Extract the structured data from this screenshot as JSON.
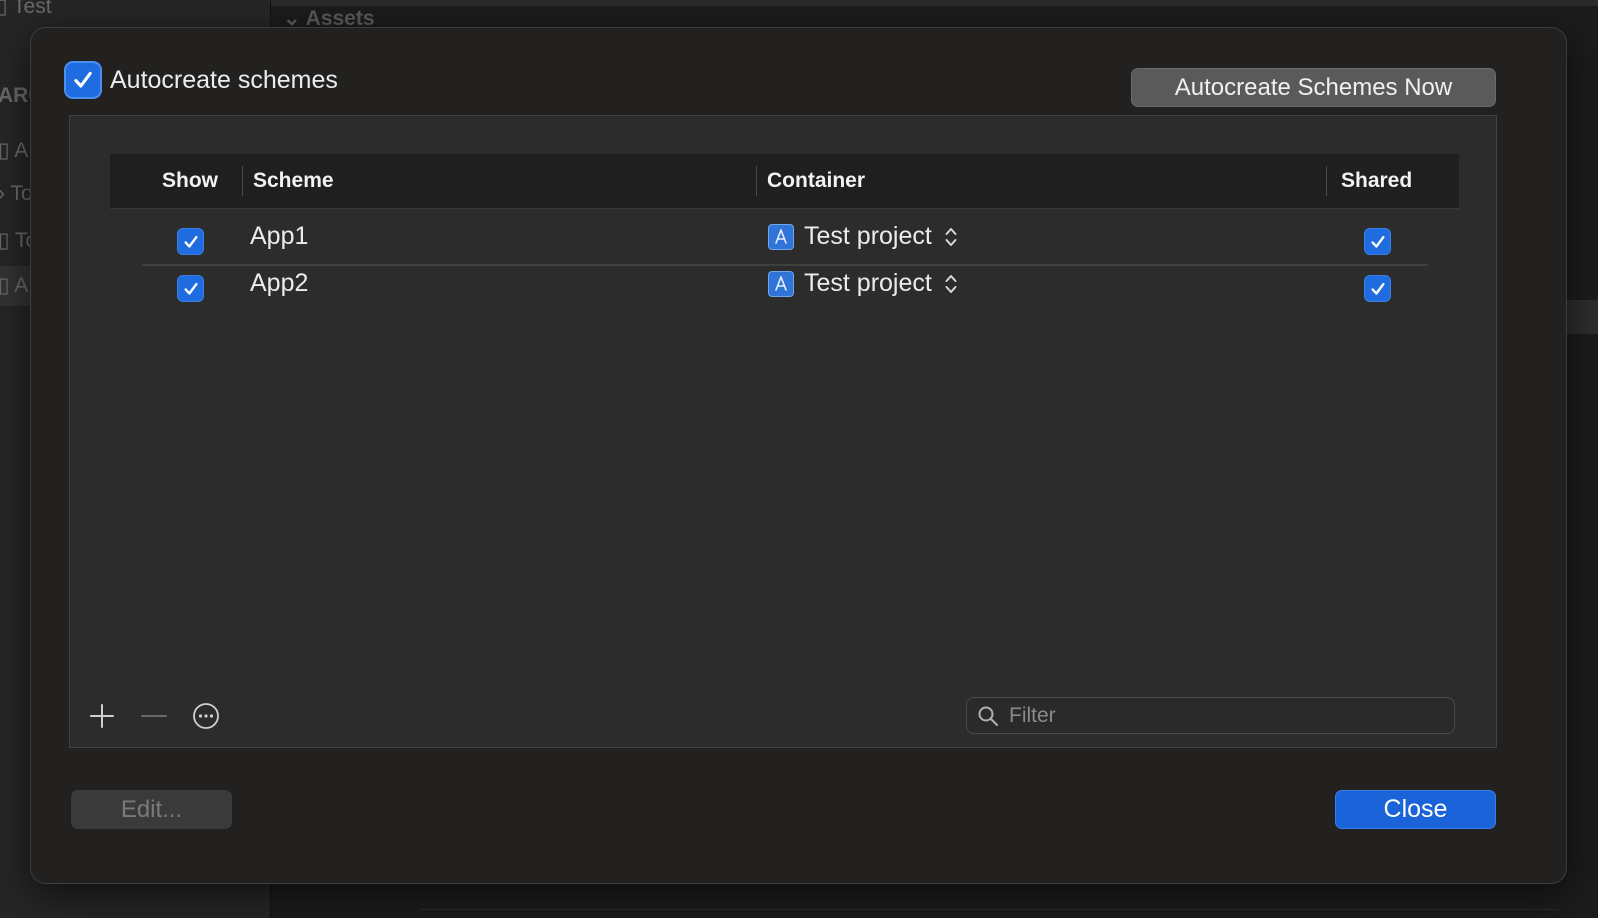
{
  "background": {
    "sidebar_items": [
      "Test",
      "ARC",
      "A",
      "To",
      "To",
      "A"
    ],
    "section_title": "Assets"
  },
  "dialog": {
    "autocreate_label": "Autocreate schemes",
    "autocreate_checked": true,
    "autocreate_now_button": "Autocreate Schemes Now",
    "columns": {
      "show": "Show",
      "scheme": "Scheme",
      "container": "Container",
      "shared": "Shared"
    },
    "rows": [
      {
        "show": true,
        "scheme": "App1",
        "container": "Test project",
        "shared": true
      },
      {
        "show": true,
        "scheme": "App2",
        "container": "Test project",
        "shared": true
      }
    ],
    "filter_placeholder": "Filter",
    "edit_button": "Edit...",
    "close_button": "Close"
  },
  "colors": {
    "accent": "#1a63d8",
    "checkbox": "#1f6ce0",
    "sheet_bg": "#222120",
    "panel_bg": "#2c2c2c"
  }
}
